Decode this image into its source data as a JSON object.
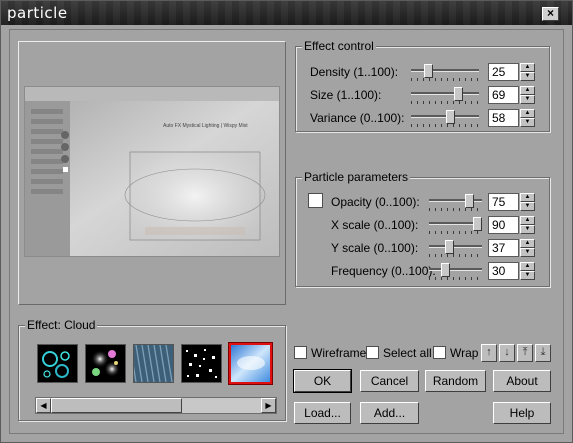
{
  "window": {
    "title": "particle",
    "close_glyph": "×"
  },
  "preview": {
    "caption": "Auto FX Mystical Lighting | Wispy Mist"
  },
  "effect_control": {
    "legend": "Effect control",
    "rows": [
      {
        "label": "Density (1..100):",
        "value": "25",
        "level": 0.25
      },
      {
        "label": "Size (1..100):",
        "value": "69",
        "level": 0.69
      },
      {
        "label": "Variance (0..100):",
        "value": "58",
        "level": 0.58
      }
    ]
  },
  "particle_parameters": {
    "legend": "Particle parameters",
    "rows": [
      {
        "label": "Opacity (0..100):",
        "value": "75",
        "level": 0.75
      },
      {
        "label": "X scale (0..100):",
        "value": "90",
        "level": 0.9
      },
      {
        "label": "Y scale (0..100):",
        "value": "37",
        "level": 0.37
      },
      {
        "label": "Frequency (0..100):",
        "value": "30",
        "level": 0.3
      }
    ]
  },
  "effect": {
    "legend": "Effect: Cloud",
    "presets": [
      {
        "name": "bubbles-preset",
        "selected": false
      },
      {
        "name": "glow-orbs-preset",
        "selected": false
      },
      {
        "name": "rain-preset",
        "selected": false
      },
      {
        "name": "stars-preset",
        "selected": false
      },
      {
        "name": "cloud-preset",
        "selected": true
      }
    ]
  },
  "options": {
    "wireframe": "Wireframe",
    "select_all": "Select all",
    "wrap": "Wrap"
  },
  "buttons": {
    "ok": "OK",
    "cancel": "Cancel",
    "random": "Random",
    "about": "About",
    "load": "Load...",
    "add": "Add...",
    "help": "Help"
  },
  "icons": {
    "close": "close-icon",
    "up": "arrow-up-icon",
    "down": "arrow-down-icon",
    "top": "move-top-icon",
    "bottom": "move-bottom-icon"
  },
  "colors": {
    "selected_border": "#e01010",
    "titlebar": "#1c1c1c",
    "dialog": "#a3a3a3"
  }
}
